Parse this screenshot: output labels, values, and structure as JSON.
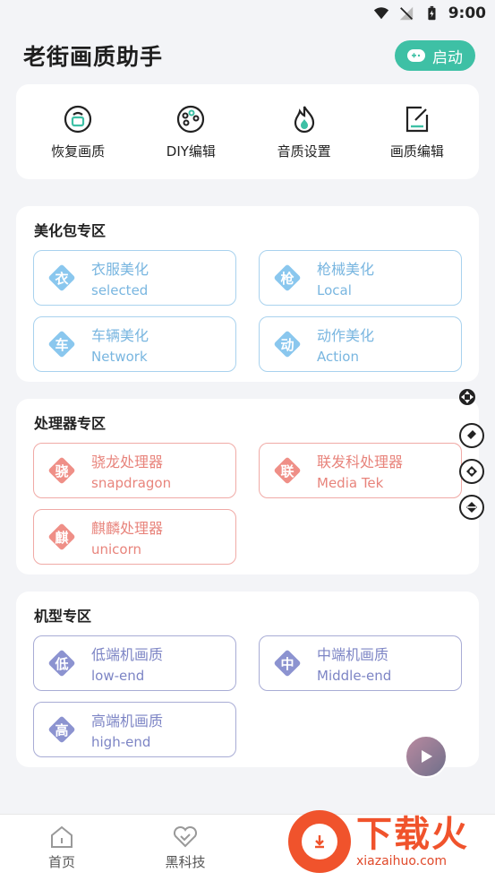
{
  "statusbar": {
    "time": "9:00"
  },
  "header": {
    "title": "老街画质助手",
    "start_label": "启动"
  },
  "tools": [
    {
      "label": "恢复画质",
      "icon": "restore-icon"
    },
    {
      "label": "DIY编辑",
      "icon": "palette-icon"
    },
    {
      "label": "音质设置",
      "icon": "flame-icon"
    },
    {
      "label": "画质编辑",
      "icon": "edit-icon"
    }
  ],
  "sections": {
    "beautify": {
      "title": "美化包专区",
      "items": [
        {
          "badge": "衣",
          "title": "衣服美化",
          "sub": "selected"
        },
        {
          "badge": "枪",
          "title": "枪械美化",
          "sub": "Local"
        },
        {
          "badge": "车",
          "title": "车辆美化",
          "sub": "Network"
        },
        {
          "badge": "动",
          "title": "动作美化",
          "sub": "Action"
        }
      ]
    },
    "processor": {
      "title": "处理器专区",
      "items": [
        {
          "badge": "骁",
          "title": "骁龙处理器",
          "sub": "snapdragon"
        },
        {
          "badge": "联",
          "title": "联发科处理器",
          "sub": "Media Tek"
        },
        {
          "badge": "麒",
          "title": "麒麟处理器",
          "sub": "unicorn"
        }
      ]
    },
    "model": {
      "title": "机型专区",
      "items": [
        {
          "badge": "低",
          "title": "低端机画质",
          "sub": "low-end"
        },
        {
          "badge": "中",
          "title": "中端机画质",
          "sub": "Middle-end"
        },
        {
          "badge": "高",
          "title": "高端机画质",
          "sub": "high-end"
        }
      ]
    }
  },
  "nav": [
    {
      "label": "首页",
      "icon": "home-icon"
    },
    {
      "label": "黑科技",
      "icon": "heart-icon"
    }
  ],
  "watermark": {
    "title": "下载火",
    "url": "xiazaihuo.com"
  },
  "colors": {
    "accent": "#3ec0a5",
    "blue": "#79b6e0",
    "red": "#e8847c",
    "purple": "#7d85c5",
    "watermark": "#f0532c"
  }
}
